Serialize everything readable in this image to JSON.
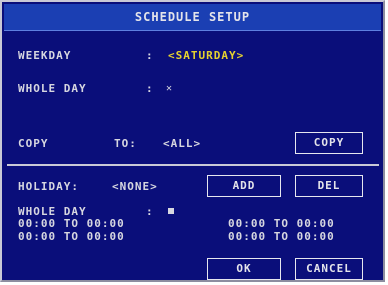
{
  "window": {
    "title": "SCHEDULE SETUP"
  },
  "weekday": {
    "label": "WEEKDAY",
    "separator": ":",
    "value": "<SATURDAY>"
  },
  "whole_day_top": {
    "label": "WHOLE DAY",
    "separator": ":",
    "checked": true,
    "glyph": "✕"
  },
  "copy": {
    "label": "COPY",
    "to_label": "TO:",
    "to_value": "<ALL>",
    "button": "COPY"
  },
  "holiday": {
    "label": "HOLIDAY:",
    "value": "<NONE>",
    "add_button": "ADD",
    "del_button": "DEL"
  },
  "whole_day_bottom": {
    "label": "WHOLE DAY",
    "separator": ":",
    "checked": true
  },
  "time_ranges": [
    {
      "start": "00:00",
      "to": "TO",
      "end": "00:00"
    },
    {
      "start": "00:00",
      "to": "TO",
      "end": "00:00"
    },
    {
      "start": "00:00",
      "to": "TO",
      "end": "00:00"
    },
    {
      "start": "00:00",
      "to": "TO",
      "end": "00:00"
    }
  ],
  "footer": {
    "ok": "OK",
    "cancel": "CANCEL"
  },
  "colors": {
    "background": "#0a0e7a",
    "title_bar": "#1b3fb3",
    "text": "#d7d7e0",
    "highlight": "#e6d22f"
  }
}
